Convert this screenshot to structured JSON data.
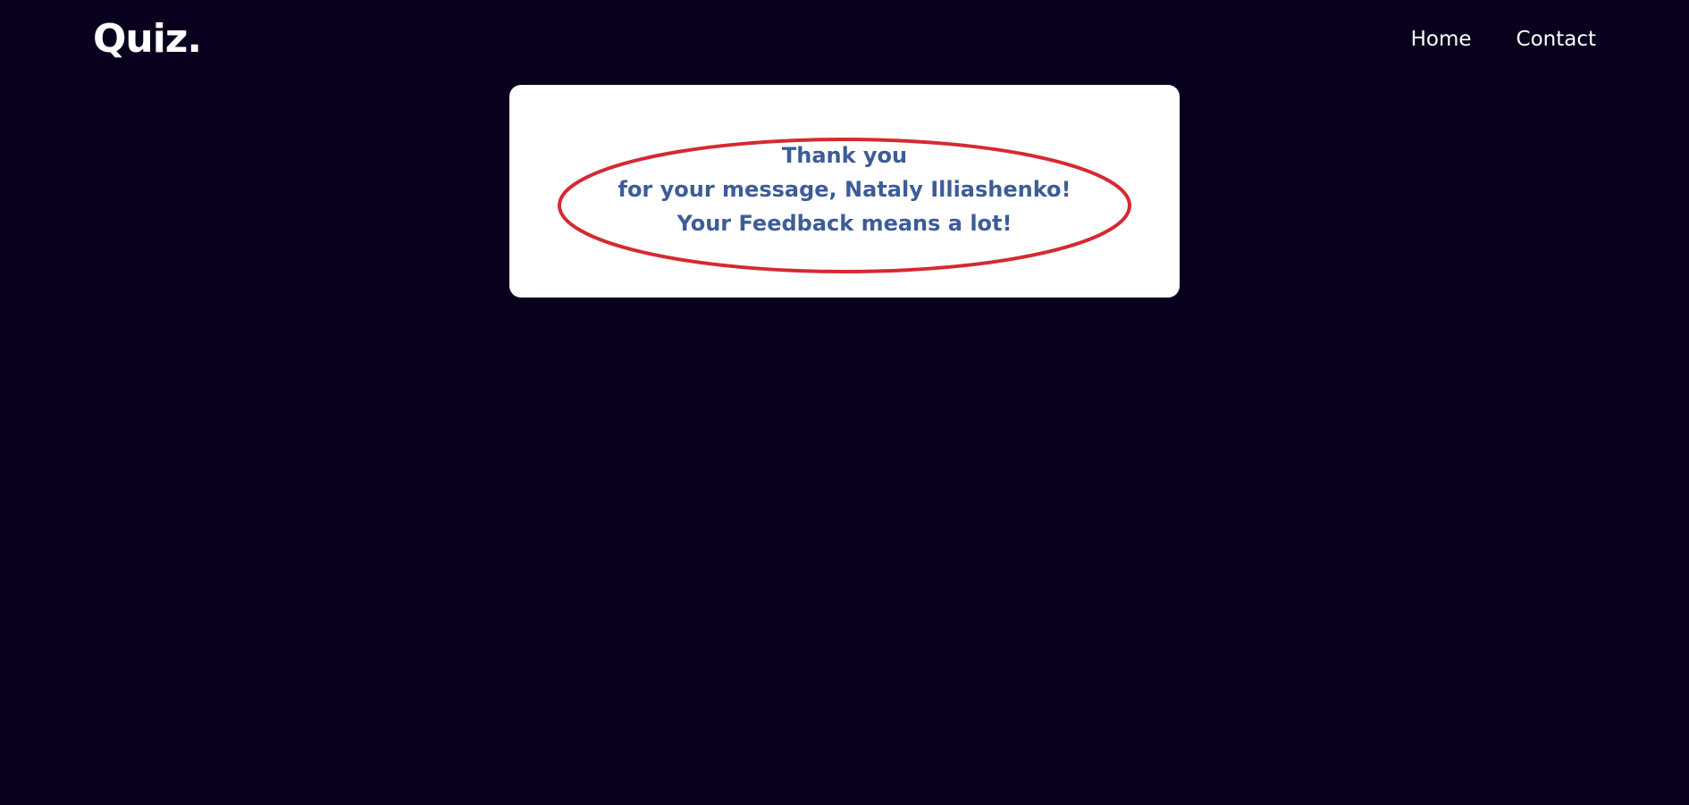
{
  "header": {
    "logo": "Quiz.",
    "nav": [
      {
        "label": "Home"
      },
      {
        "label": "Contact"
      }
    ]
  },
  "card": {
    "lines": [
      "Thank you",
      "for your message, Nataly Illiashenko!",
      "Your Feedback means a lot!"
    ]
  },
  "colors": {
    "background": "#08001d",
    "card": "#ffffff",
    "message_text": "#3d5c98",
    "ellipse": "#d42a32",
    "nav_text": "#ffffff"
  }
}
